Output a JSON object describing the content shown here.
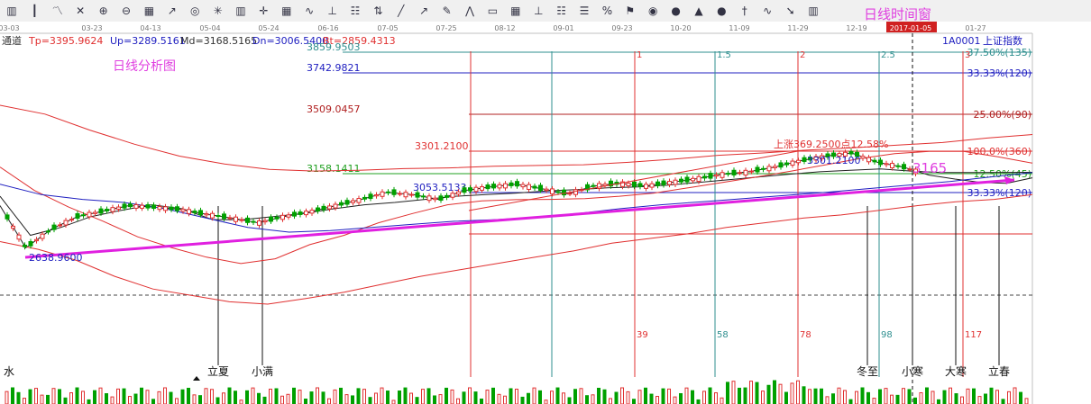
{
  "toolbar": {
    "window_title": "日线时间窗",
    "icons": [
      "bar-chart-icon",
      "candle-icon",
      "line-icon",
      "cross-icon",
      "zoom-in-icon",
      "zoom-out-icon",
      "grid-icon",
      "fan-icon",
      "target-icon",
      "snowflake-icon",
      "bar-chart-icon",
      "crosshair-icon",
      "grid-icon",
      "wave-icon",
      "split-icon",
      "table-icon",
      "price-scale-icon",
      "draw-line-icon",
      "fan-icon",
      "pencil-icon",
      "zigzag-icon",
      "box-icon",
      "grid-icon",
      "split-icon",
      "table-icon",
      "list-icon",
      "percent-icon",
      "flag-icon",
      "gold-coin-icon",
      "coin-icon",
      "marker-icon",
      "coin-icon",
      "pin-icon",
      "wave-icon",
      "arrow-icon",
      "bar-chart-icon"
    ]
  },
  "header": {
    "left_label": "通道",
    "tp": "Tp=3395.9624",
    "up": "Up=3289.5161",
    "md": "Md=3168.5165",
    "dn": "Dn=3006.5400",
    "bt": "Bt=2859.4313",
    "code": "1A0001",
    "index_name": "上证指数"
  },
  "chart_title": "日线分析图",
  "date_axis": {
    "labels": [
      "03-03",
      "03-23",
      "04-13",
      "05-04",
      "05-24",
      "06-16",
      "07-05",
      "07-25",
      "08-12",
      "09-01",
      "09-23",
      "10-20",
      "11-09",
      "11-29",
      "12-19",
      "2017-01-05",
      "01-27"
    ],
    "highlight": "2017-01-05"
  },
  "chart_data": {
    "type": "line",
    "xlabel": "",
    "ylabel": "",
    "ylim": [
      2600,
      3900
    ],
    "grid": false,
    "channel": {
      "tp": 3395.9624,
      "up": 3289.5161,
      "md": 3168.5165,
      "dn": 3006.54,
      "bt": 2859.4313
    },
    "price_levels": [
      {
        "price": "3859.9503",
        "label": "37.50%(135)",
        "color": "#2f8f8f"
      },
      {
        "price": "3742.9821",
        "label": "33.33%(120)",
        "color": "#2020c0"
      },
      {
        "price": "3509.0457",
        "label": "25.00%(90)",
        "color": "#b02020"
      },
      {
        "price": "3301.2100",
        "label": "100.0%(360)",
        "color": "#e03030"
      },
      {
        "price": "3158.1411",
        "label": "12.50%(45)",
        "color": "#20a020"
      },
      {
        "price": "3053.5133",
        "label": "33.33%(120)",
        "color": "#2020c0"
      }
    ],
    "trend_low": "2638.9600",
    "trend_high_label": "3301.2100",
    "rise_annotation": "上涨369.2500点12.58%",
    "target_label": "3165",
    "time_windows": [
      {
        "label": "1",
        "count": "39"
      },
      {
        "label": "1.5",
        "count": "58"
      },
      {
        "label": "2",
        "count": "78"
      },
      {
        "label": "2.5",
        "count": "98"
      },
      {
        "label": "3",
        "count": "117"
      }
    ],
    "solar_terms": [
      "水",
      "立夏",
      "小满",
      "冬至",
      "小寒",
      "大寒",
      "立春"
    ],
    "series": [
      {
        "values": [
          2970,
          2700,
          2820,
          2900,
          2935,
          2970,
          2960,
          2945,
          2915,
          2890,
          2860,
          2900,
          2930,
          2970,
          3010,
          3055,
          3040,
          3010,
          3065,
          3085,
          3100,
          3075,
          3045,
          3090,
          3105,
          3090,
          3110,
          3130,
          3155,
          3170,
          3200,
          3240,
          3270,
          3290,
          3230,
          3200,
          3150,
          3128,
          3110,
          3105,
          3135
        ]
      },
      {
        "values": [
          3030,
          2780,
          2830,
          2900,
          2940,
          2975,
          2950,
          2880,
          2880,
          2900,
          2920,
          2950,
          2975,
          2990,
          3010,
          3030,
          3040,
          3050,
          3062,
          3070,
          3080,
          3085,
          3095,
          3110,
          3125,
          3140,
          3155,
          3170,
          3180,
          3188,
          3175,
          3165,
          3165,
          3166,
          3167
        ]
      },
      {
        "values": [
          3200,
          3065,
          2960,
          2870,
          2770,
          2700,
          2640,
          2600,
          2630,
          2720,
          2780,
          2860,
          2920,
          2975,
          3000,
          3008,
          3010,
          3015,
          3030,
          3050,
          3080,
          3110,
          3140,
          3175,
          3215,
          3255,
          3285,
          3300,
          3300,
          3265,
          3225
        ]
      },
      {
        "values": [
          3560,
          3510,
          3420,
          3340,
          3270,
          3220,
          3185,
          3175,
          3180,
          3190,
          3195,
          3205,
          3210,
          3215,
          3230,
          3250,
          3275,
          3290,
          3308,
          3320,
          3335,
          3350,
          3375,
          3395
        ]
      },
      {
        "values": [
          3100,
          3040,
          3010,
          2990,
          2950,
          2890,
          2830,
          2800,
          2810,
          2830,
          2850,
          2870,
          2880,
          2895,
          2920,
          2950,
          2975,
          2995,
          3015,
          3035,
          3055,
          3075,
          3095,
          3115,
          3140,
          3165
        ]
      },
      {
        "values": [
          2740,
          2690,
          2620,
          2520,
          2440,
          2400,
          2360,
          2345,
          2380,
          2420,
          2470,
          2520,
          2560,
          2600,
          2640,
          2680,
          2730,
          2760,
          2790,
          2830,
          2860,
          2890,
          2910,
          2940,
          2970,
          2995,
          3010,
          3040
        ]
      }
    ]
  }
}
